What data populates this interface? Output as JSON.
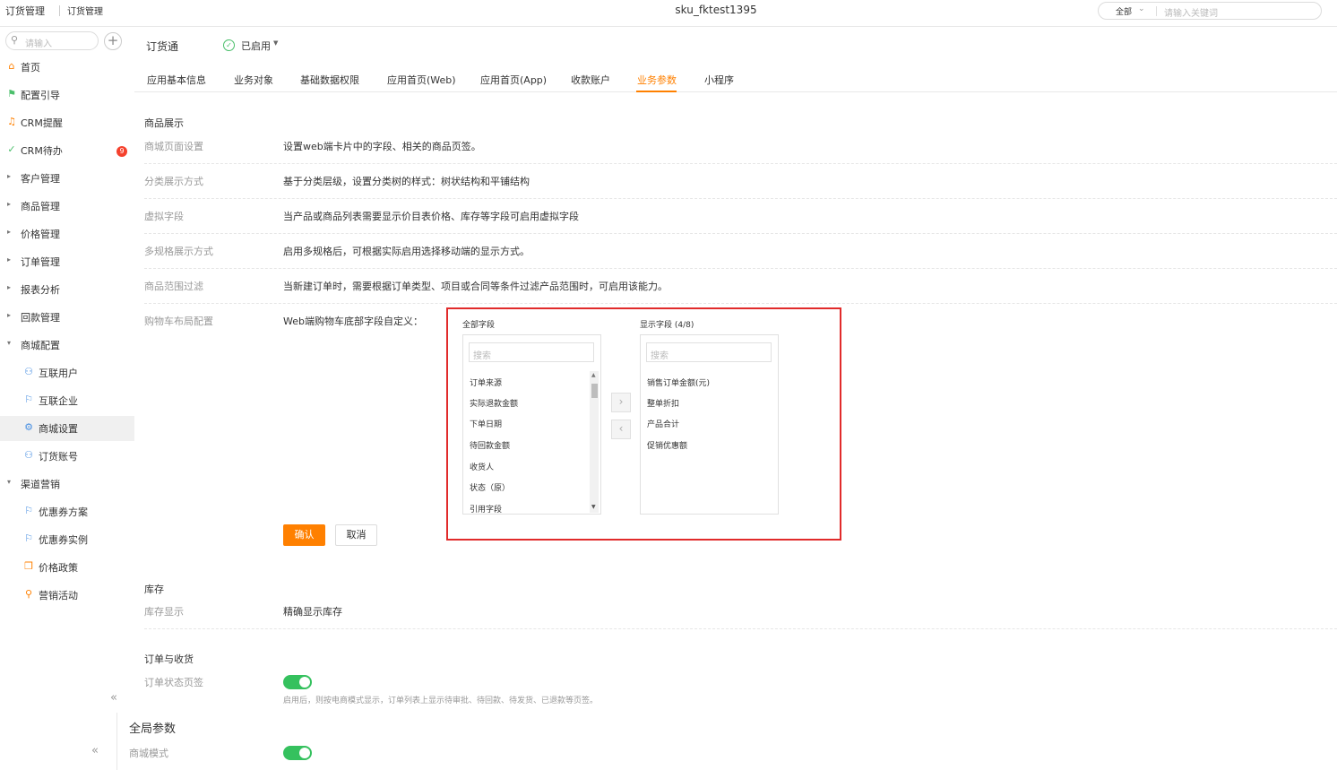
{
  "topbar": {
    "tab1": "订货管理",
    "tab2": "订货管理",
    "title": "sku_fktest1395",
    "search_scope": "全部",
    "search_placeholder": "请输入关键词"
  },
  "sidebar": {
    "search_placeholder": "请输入",
    "items": [
      {
        "label": "首页",
        "icon": "home-icon"
      },
      {
        "label": "配置引导",
        "icon": "guide-icon"
      },
      {
        "label": "CRM提醒",
        "icon": "bell-icon"
      },
      {
        "label": "CRM待办",
        "icon": "check-icon",
        "badge": "9"
      },
      {
        "label": "客户管理"
      },
      {
        "label": "商品管理"
      },
      {
        "label": "价格管理"
      },
      {
        "label": "订单管理"
      },
      {
        "label": "报表分析"
      },
      {
        "label": "回款管理"
      },
      {
        "label": "商城配置"
      },
      {
        "label": "互联用户",
        "icon": "users-icon"
      },
      {
        "label": "互联企业",
        "icon": "flag-icon"
      },
      {
        "label": "商城设置",
        "icon": "gear-icon"
      },
      {
        "label": "订货账号",
        "icon": "users-icon"
      },
      {
        "label": "渠道营销"
      },
      {
        "label": "优惠券方案",
        "icon": "flag-icon"
      },
      {
        "label": "优惠券实例",
        "icon": "flag-icon"
      },
      {
        "label": "价格政策",
        "icon": "cube-icon"
      },
      {
        "label": "营销活动",
        "icon": "user-icon"
      }
    ]
  },
  "header": {
    "app_name": "订货通",
    "status": "已启用"
  },
  "tabs": [
    "应用基本信息",
    "业务对象",
    "基础数据权限",
    "应用首页(Web)",
    "应用首页(App)",
    "收款账户",
    "业务参数",
    "小程序"
  ],
  "goods_section": {
    "title": "商品展示",
    "rows": [
      {
        "label": "商城页面设置",
        "text": "设置web端卡片中的字段、相关的商品页签。"
      },
      {
        "label": "分类展示方式",
        "text": "基于分类层级，设置分类树的样式：树状结构和平铺结构"
      },
      {
        "label": "虚拟字段",
        "text": "当产品或商品列表需要显示价目表价格、库存等字段可启用虚拟字段"
      },
      {
        "label": "多规格展示方式",
        "text": "启用多规格后，可根据实际启用选择移动端的显示方式。"
      },
      {
        "label": "商品范围过滤",
        "text": "当新建订单时，需要根据订单类型、项目或合同等条件过滤产品范围时，可启用该能力。"
      },
      {
        "label": "购物车布局配置",
        "text": "Web端购物车底部字段自定义："
      }
    ]
  },
  "transfer": {
    "left_title": "全部字段",
    "right_title": "显示字段 (4/8)",
    "search_placeholder": "搜索",
    "left_items": [
      "订单来源",
      "实际退款金额",
      "下单日期",
      "待回款金额",
      "收货人",
      "状态（原）",
      "引用字段"
    ],
    "right_items": [
      "销售订单金额(元)",
      "整单折扣",
      "产品合计",
      "促销优惠额"
    ],
    "move_right": "›",
    "move_left": "‹"
  },
  "buttons": {
    "confirm": "确认",
    "cancel": "取消"
  },
  "stock_section": {
    "title": "库存",
    "label": "库存显示",
    "value": "精确显示库存"
  },
  "order_section": {
    "title": "订单与收货",
    "label": "订单状态页签",
    "toggle_on": true,
    "hint": "启用后，则按电商模式显示，订单列表上显示待审批、待回款、待发货、已退款等页签。"
  },
  "global_section": {
    "title": "全局参数",
    "label": "商城模式",
    "toggle_on": true
  },
  "colors": {
    "accent": "#ff8000",
    "toggle": "#35c15e",
    "highlight": "#e12b2b",
    "badge": "#f5412d"
  }
}
